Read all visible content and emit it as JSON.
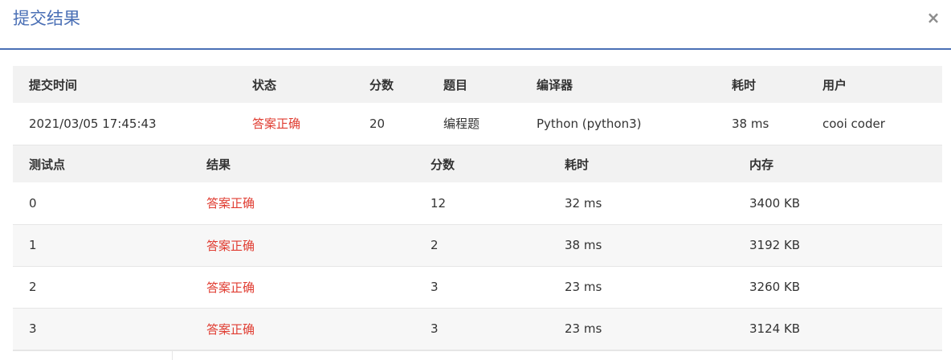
{
  "modal": {
    "title": "提交结果",
    "close_label": "×"
  },
  "summary": {
    "headers": [
      "提交时间",
      "状态",
      "分数",
      "题目",
      "编译器",
      "耗时",
      "用户"
    ],
    "row": {
      "time": "2021/03/05 17:45:43",
      "status": "答案正确",
      "score": "20",
      "problem": "编程题",
      "compiler": "Python (python3)",
      "duration": "38 ms",
      "user": "cooi coder"
    }
  },
  "cases": {
    "headers": [
      "测试点",
      "结果",
      "分数",
      "耗时",
      "内存"
    ],
    "rows": [
      {
        "id": "0",
        "result": "答案正确",
        "score": "12",
        "duration": "32 ms",
        "memory": "3400 KB"
      },
      {
        "id": "1",
        "result": "答案正确",
        "score": "2",
        "duration": "38 ms",
        "memory": "3192 KB"
      },
      {
        "id": "2",
        "result": "答案正确",
        "score": "3",
        "duration": "23 ms",
        "memory": "3260 KB"
      },
      {
        "id": "3",
        "result": "答案正确",
        "score": "3",
        "duration": "23 ms",
        "memory": "3124 KB"
      }
    ]
  },
  "colors": {
    "accent": "#4a6fb5",
    "success_text": "#e03c31",
    "header_bg": "#f2f2f2"
  }
}
